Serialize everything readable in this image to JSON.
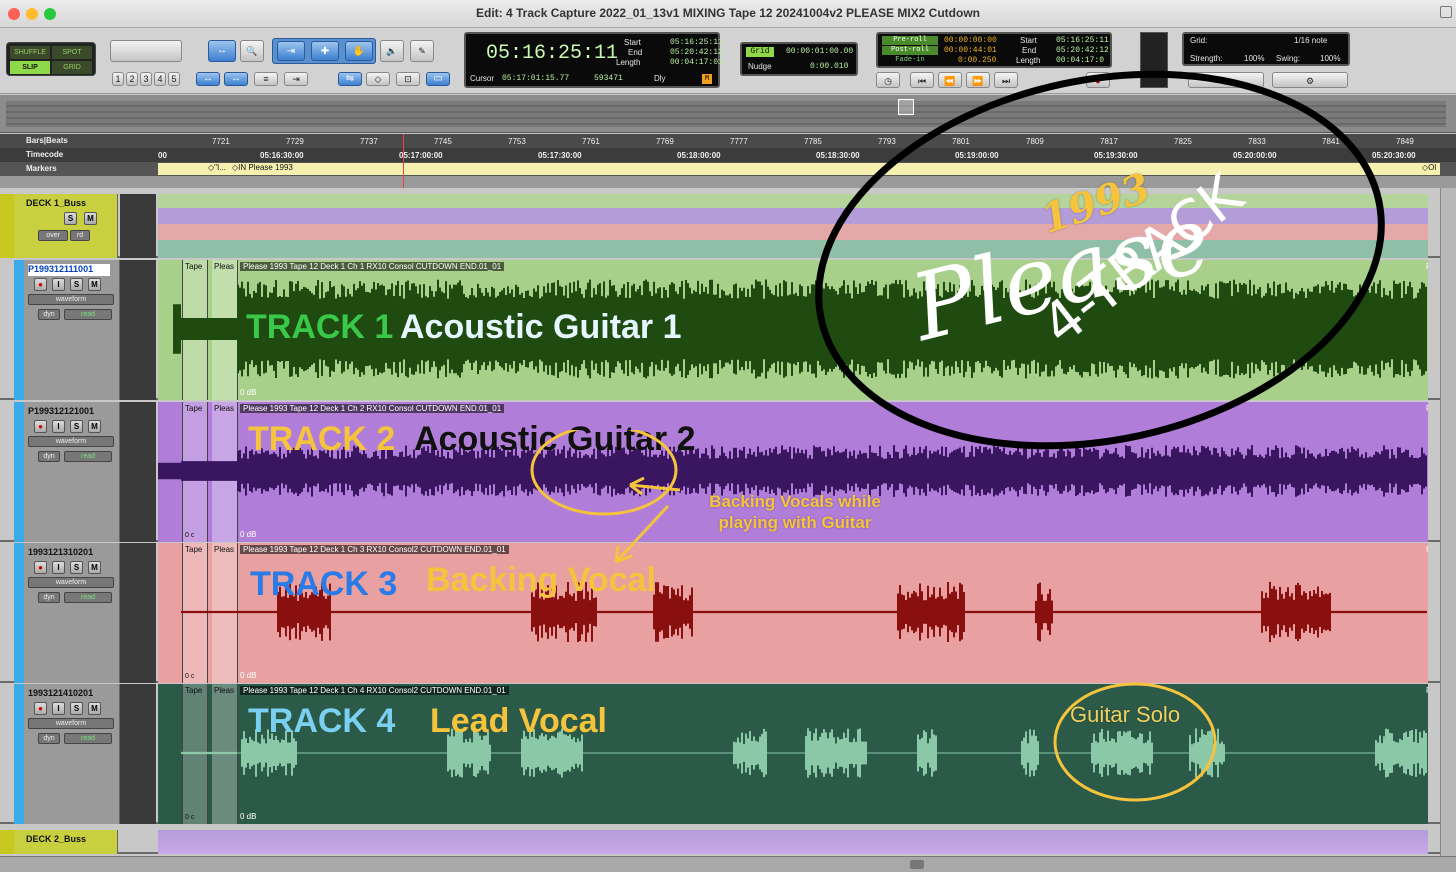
{
  "window": {
    "title": "Edit: 4 Track Capture 2022_01_13v1 MIXING Tape 12 20241004v2 PLEASE MIX2 Cutdown"
  },
  "modes": {
    "shuffle": "SHUFFLE",
    "spot": "SPOT",
    "slip": "SLIP",
    "grid": "GRID"
  },
  "zoom_presets": [
    "1",
    "2",
    "3",
    "4",
    "5"
  ],
  "counter": {
    "main": "05:16:25:11",
    "start_label": "Start",
    "end_label": "End",
    "length_label": "Length",
    "start": "05:16:25:11",
    "end": "05:20:42:12",
    "length": "00:04:17:01",
    "cursor_label": "Cursor",
    "cursor": "05:17:01:15.77",
    "sample": "593471",
    "dly": "Dly"
  },
  "grid": {
    "label": "Grid",
    "value": "00:00:01:00.00",
    "nudge_label": "Nudge",
    "nudge_value": "0:00.010"
  },
  "transport": {
    "preroll_label": "Pre-roll",
    "postroll_label": "Post-roll",
    "fadein_label": "Fade-in",
    "preroll": "00:00:00:00",
    "postroll": "00:00:44:01",
    "fadein": "0:00.250",
    "start_label": "Start",
    "end_label": "End",
    "length_label": "Length",
    "start": "05:16:25:11",
    "end": "05:20:42:12",
    "length": "00:04:17:0"
  },
  "quantize": {
    "grid_label": "Grid:",
    "grid_value": "1/16 note",
    "strength_label": "Strength:",
    "strength": "100%",
    "swing_label": "Swing:",
    "swing": "100%"
  },
  "rulers": {
    "bars_label": "Bars|Beats",
    "timecode_label": "Timecode",
    "markers_label": "Markers",
    "bars": [
      "7721",
      "7729",
      "7737",
      "7745",
      "7753",
      "7761",
      "7769",
      "7777",
      "7785",
      "7793",
      "7801",
      "7809",
      "7817",
      "7825",
      "7833",
      "7841",
      "7849"
    ],
    "timecode": [
      "00",
      "05:16:30:00",
      "05:17:00:00",
      "05:17:30:00",
      "05:18:00:00",
      "05:18:30:00",
      "05:19:00:00",
      "05:19:30:00",
      "05:20:00:00",
      "05:20:30:00"
    ],
    "marker1": "\"I...",
    "marker2": "IN Please 1993",
    "marker3": "Ol"
  },
  "buss1": {
    "name": "DECK 1_Buss",
    "s": "S",
    "m": "M",
    "auto": "over",
    "rd": "rd"
  },
  "buss2": {
    "name": "DECK 2_Buss"
  },
  "tracks": [
    {
      "name": "P199312111001",
      "wave": "waveform",
      "dyn": "dyn",
      "read": "read",
      "clip": "Please 1993 Tape 12 Deck 1 Ch 1 RX10 Consol CUTDOWN END.01_01",
      "tape": "Tape",
      "pleas": "Pleas",
      "db": "0 dB",
      "label_num": "TRACK 1",
      "label_name": "Acoustic Guitar 1",
      "right_clip": "Ple"
    },
    {
      "name": "P199312121001",
      "wave": "waveform",
      "dyn": "dyn",
      "read": "read",
      "clip": "Please 1993 Tape 12 Deck 1 Ch 2 RX10 Consol CUTDOWN END.01_01",
      "tape": "Tape",
      "pleas": "Pleas",
      "db": "0 dB",
      "left_db": "0 c",
      "label_num": "TRACK 2",
      "label_name": "Acoustic Guitar 2",
      "right_clip": "Ple"
    },
    {
      "name": "1993121310201",
      "wave": "waveform",
      "dyn": "dyn",
      "read": "read",
      "clip": "Please 1993 Tape 12 Deck 1 Ch 3 RX10 Consol2 CUTDOWN END.01_01",
      "tape": "Tape",
      "pleas": "Pleas",
      "db": "0 dB",
      "left_db": "0 c",
      "label_num": "TRACK 3",
      "label_name": "Backing Vocal",
      "right_clip": "Ple"
    },
    {
      "name": "1993121410201",
      "wave": "waveform",
      "dyn": "dyn",
      "read": "read",
      "clip": "Please 1993 Tape 12 Deck 1 Ch 4 RX10 Consol2 CUTDOWN END.01_01",
      "tape": "Tape",
      "pleas": "Pleas",
      "db": "0 dB",
      "left_db": "0 c",
      "label_num": "TRACK 4",
      "label_name": "Lead Vocal",
      "right_clip": "Ple"
    }
  ],
  "annotations": {
    "year": "1993",
    "title1": "Please",
    "title2": "4-TRACK",
    "backing1": "Backing Vocals while",
    "backing2": "playing with Guitar",
    "solo": "Guitar Solo"
  },
  "colors": {
    "track1": "#a8d08a",
    "track2": "#b07ed8",
    "track3": "#e8a0a0",
    "track4": "#2c5a48",
    "annot": "#f5c43c"
  }
}
